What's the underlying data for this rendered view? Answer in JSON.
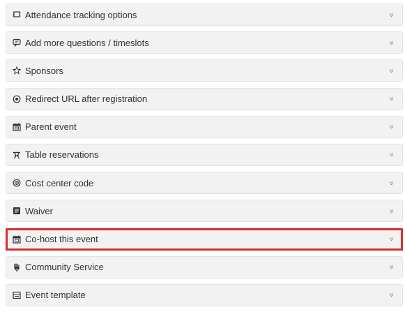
{
  "accordion": {
    "items": [
      {
        "label": "Attendance tracking options",
        "icon": "attendance-icon"
      },
      {
        "label": "Add more questions / timeslots",
        "icon": "comment-icon"
      },
      {
        "label": "Sponsors",
        "icon": "star-icon"
      },
      {
        "label": "Redirect URL after registration",
        "icon": "target-icon"
      },
      {
        "label": "Parent event",
        "icon": "calendar-icon"
      },
      {
        "label": "Table reservations",
        "icon": "table-icon"
      },
      {
        "label": "Cost center code",
        "icon": "coin-icon"
      },
      {
        "label": "Waiver",
        "icon": "document-icon"
      },
      {
        "label": "Co-host this event",
        "icon": "calendar-icon",
        "highlighted": true
      },
      {
        "label": "Community Service",
        "icon": "hand-icon"
      },
      {
        "label": "Event template",
        "icon": "template-icon"
      }
    ],
    "chevron_glyph": "»",
    "highlight_color": "#d32f2f"
  }
}
